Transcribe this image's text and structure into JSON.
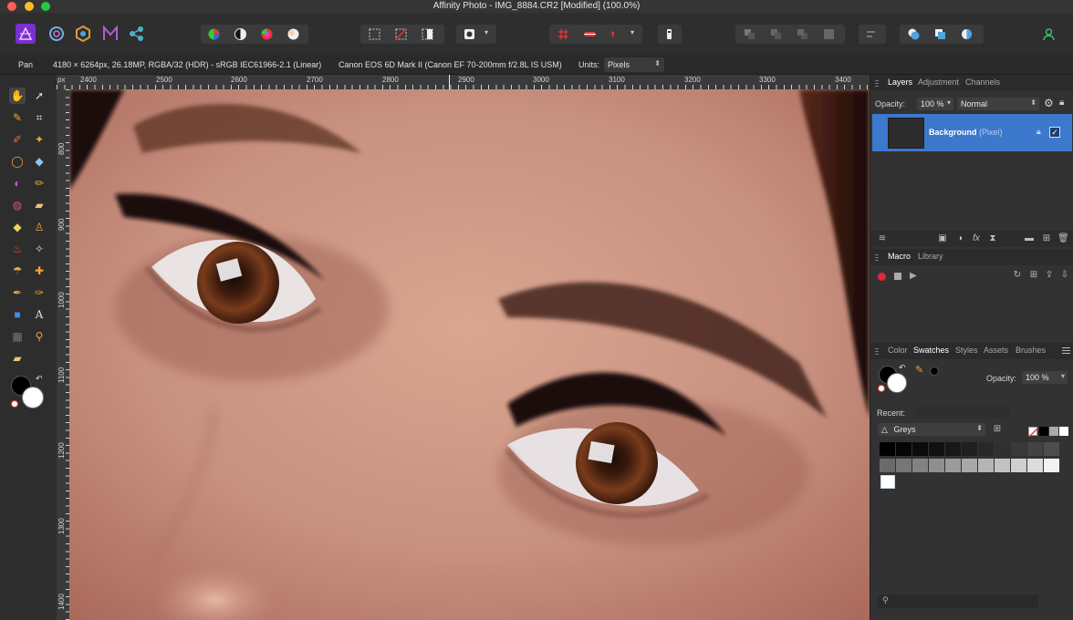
{
  "window": {
    "title": "Affinity Photo - IMG_8884.CR2 [Modified] (100.0%)"
  },
  "context": {
    "tool_name": "Pan",
    "image_info": "4180 × 6264px, 26.18MP, RGBA/32 (HDR) - sRGB IEC61966-2.1 (Linear)",
    "camera_info": "Canon EOS 6D Mark II (Canon EF 70-200mm f/2.8L IS USM)",
    "units_label": "Units:",
    "units_value": "Pixels"
  },
  "ruler": {
    "unit": "px",
    "x_labels": [
      "2400",
      "2500",
      "2600",
      "2700",
      "2800",
      "2900",
      "3000",
      "3100",
      "3200",
      "3300",
      "3400"
    ],
    "y_labels": [
      "800",
      "900",
      "1000",
      "1100",
      "1200",
      "1300",
      "1400"
    ]
  },
  "layers_panel": {
    "tabs": [
      "Layers",
      "Adjustment",
      "Channels"
    ],
    "opacity_label": "Opacity:",
    "opacity_value": "100 %",
    "blend_mode": "Normal",
    "layer": {
      "name": "Background",
      "type": "(Pixel)"
    }
  },
  "macro_panel": {
    "tabs": [
      "Macro",
      "Library"
    ]
  },
  "swatches_panel": {
    "tabs": [
      "Color",
      "Swatches",
      "Styles",
      "Assets",
      "Brushes"
    ],
    "opacity_label": "Opacity:",
    "opacity_value": "100 %",
    "recent_label": "Recent:",
    "palette_name": "Greys",
    "grey_swatches": [
      "#000000",
      "#060606",
      "#0b0b0b",
      "#111111",
      "#181818",
      "#1f1f1f",
      "#282828",
      "#303030",
      "#393939",
      "#434343",
      "#4d4d4d",
      "#6a6a6a",
      "#767676",
      "#828282",
      "#8f8f8f",
      "#9b9b9b",
      "#a8a8a8",
      "#b5b5b5",
      "#c2c2c2",
      "#cfcfcf",
      "#dcdcdc",
      "#f2f2f2"
    ],
    "recent_swatch": "#ffffff"
  },
  "colors": {
    "accent": "#3c78cc",
    "panel": "#323232",
    "background": "#2b2b2b"
  }
}
